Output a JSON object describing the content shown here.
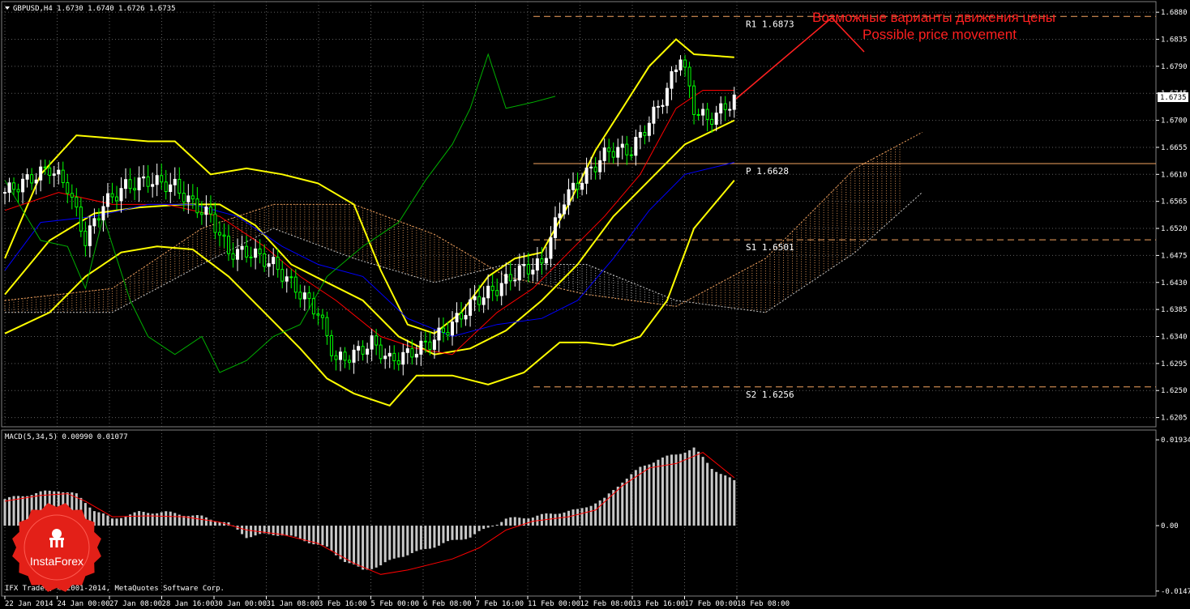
{
  "header": {
    "symbol_line": "GBPUSD,H4  1.6730 1.6740 1.6726 1.6735",
    "macd_line": "MACD(5,34,5) 0.00990 0.01077",
    "copyright": "IFX Trader, © 2001-2014, MetaQuotes Software Corp."
  },
  "annotation": {
    "line1": "Возможные варианты движения цены",
    "line2": "Possible price movement",
    "color": "#ff2020"
  },
  "logo": {
    "text": "InstaForex",
    "color": "#e32018"
  },
  "colors": {
    "bull": "#ffffff",
    "bear": "#00ff00",
    "bollinger": "#ffff00",
    "kijun": "#ff0000",
    "tenkan": "#0000ff",
    "chikou": "#00b000",
    "cloud_up": "#f4a460",
    "cloud_down": "#c8c8c8",
    "pivot": "#f4a460",
    "grid": "#606060",
    "macd_hist": "#c8c8c8",
    "macd_signal": "#ff0000"
  },
  "levels": [
    {
      "name": "R1",
      "label": "R1  1.6873",
      "value": 1.6873,
      "style": "dash"
    },
    {
      "name": "P",
      "label": "P  1.6628",
      "value": 1.6628,
      "style": "solid"
    },
    {
      "name": "S1",
      "label": "S1  1.6501",
      "value": 1.6501,
      "style": "dash"
    },
    {
      "name": "S2",
      "label": "S2  1.6256",
      "value": 1.6256,
      "style": "dash"
    }
  ],
  "current_price": "1.6735",
  "chart_data": [
    {
      "type": "candlestick",
      "title": "GBPUSD,H4",
      "ylim": [
        1.6195,
        1.6895
      ],
      "y_ticks": [
        "1.6880",
        "1.6835",
        "1.6790",
        "1.6745",
        "1.6700",
        "1.6655",
        "1.6610",
        "1.6565",
        "1.6520",
        "1.6475",
        "1.6430",
        "1.6385",
        "1.6340",
        "1.6295",
        "1.6250",
        "1.6205"
      ],
      "x_ticks": [
        "22 Jan 2014",
        "24 Jan 00:00",
        "27 Jan 08:00",
        "28 Jan 16:00",
        "30 Jan 00:00",
        "31 Jan 08:00",
        "3 Feb 16:00",
        "5 Feb 00:00",
        "6 Feb 08:00",
        "7 Feb 16:00",
        "11 Feb 00:00",
        "12 Feb 08:00",
        "13 Feb 16:00",
        "17 Feb 00:00",
        "18 Feb 08:00"
      ],
      "close_anchors": [
        [
          0,
          1.658
        ],
        [
          5,
          1.66
        ],
        [
          10,
          1.662
        ],
        [
          14,
          1.659
        ],
        [
          18,
          1.65
        ],
        [
          22,
          1.656
        ],
        [
          27,
          1.659
        ],
        [
          32,
          1.66
        ],
        [
          38,
          1.659
        ],
        [
          42,
          1.656
        ],
        [
          46,
          1.654
        ],
        [
          50,
          1.648
        ],
        [
          55,
          1.648
        ],
        [
          60,
          1.646
        ],
        [
          65,
          1.642
        ],
        [
          70,
          1.638
        ],
        [
          74,
          1.63
        ],
        [
          78,
          1.631
        ],
        [
          82,
          1.633
        ],
        [
          86,
          1.63
        ],
        [
          90,
          1.631
        ],
        [
          95,
          1.633
        ],
        [
          100,
          1.636
        ],
        [
          105,
          1.64
        ],
        [
          110,
          1.642
        ],
        [
          115,
          1.645
        ],
        [
          120,
          1.646
        ],
        [
          125,
          1.657
        ],
        [
          130,
          1.661
        ],
        [
          135,
          1.665
        ],
        [
          140,
          1.665
        ],
        [
          145,
          1.671
        ],
        [
          148,
          1.675
        ],
        [
          151,
          1.681
        ],
        [
          154,
          1.672
        ],
        [
          157,
          1.67
        ],
        [
          160,
          1.6716
        ],
        [
          163,
          1.6735
        ]
      ],
      "series": [
        {
          "name": "Bollinger Bands",
          "upper": [
            [
              0,
              1.647
            ],
            [
              8,
              1.661
            ],
            [
              16,
              1.6675
            ],
            [
              24,
              1.667
            ],
            [
              32,
              1.6665
            ],
            [
              38,
              1.6665
            ],
            [
              46,
              1.661
            ],
            [
              54,
              1.662
            ],
            [
              62,
              1.661
            ],
            [
              70,
              1.6595
            ],
            [
              78,
              1.656
            ],
            [
              84,
              1.645
            ],
            [
              90,
              1.636
            ],
            [
              96,
              1.6345
            ],
            [
              102,
              1.638
            ],
            [
              108,
              1.644
            ],
            [
              114,
              1.647
            ],
            [
              120,
              1.648
            ],
            [
              126,
              1.656
            ],
            [
              132,
              1.665
            ],
            [
              138,
              1.672
            ],
            [
              144,
              1.679
            ],
            [
              150,
              1.6835
            ],
            [
              154,
              1.681
            ],
            [
              163,
              1.6805
            ]
          ],
          "middle": [
            [
              0,
              1.641
            ],
            [
              10,
              1.65
            ],
            [
              20,
              1.6545
            ],
            [
              30,
              1.6555
            ],
            [
              40,
              1.656
            ],
            [
              48,
              1.656
            ],
            [
              56,
              1.6525
            ],
            [
              64,
              1.646
            ],
            [
              72,
              1.643
            ],
            [
              80,
              1.64
            ],
            [
              88,
              1.634
            ],
            [
              96,
              1.631
            ],
            [
              104,
              1.632
            ],
            [
              112,
              1.635
            ],
            [
              120,
              1.64
            ],
            [
              128,
              1.646
            ],
            [
              136,
              1.654
            ],
            [
              144,
              1.66
            ],
            [
              152,
              1.666
            ],
            [
              163,
              1.67
            ]
          ],
          "lower": [
            [
              0,
              1.6345
            ],
            [
              10,
              1.638
            ],
            [
              18,
              1.644
            ],
            [
              26,
              1.648
            ],
            [
              34,
              1.649
            ],
            [
              42,
              1.6485
            ],
            [
              50,
              1.644
            ],
            [
              58,
              1.638
            ],
            [
              66,
              1.632
            ],
            [
              72,
              1.627
            ],
            [
              78,
              1.6245
            ],
            [
              86,
              1.6225
            ],
            [
              92,
              1.6275
            ],
            [
              100,
              1.6275
            ],
            [
              108,
              1.626
            ],
            [
              116,
              1.628
            ],
            [
              124,
              1.633
            ],
            [
              130,
              1.633
            ],
            [
              136,
              1.6325
            ],
            [
              142,
              1.634
            ],
            [
              148,
              1.64
            ],
            [
              154,
              1.652
            ],
            [
              163,
              1.66
            ]
          ]
        },
        {
          "name": "Ichimoku Kijun",
          "values": [
            [
              0,
              1.655
            ],
            [
              12,
              1.658
            ],
            [
              24,
              1.656
            ],
            [
              36,
              1.656
            ],
            [
              48,
              1.654
            ],
            [
              58,
              1.649
            ],
            [
              66,
              1.644
            ],
            [
              74,
              1.64
            ],
            [
              84,
              1.634
            ],
            [
              92,
              1.632
            ],
            [
              100,
              1.631
            ],
            [
              110,
              1.638
            ],
            [
              118,
              1.642
            ],
            [
              126,
              1.648
            ],
            [
              134,
              1.654
            ],
            [
              142,
              1.661
            ],
            [
              150,
              1.672
            ],
            [
              156,
              1.675
            ],
            [
              163,
              1.675
            ]
          ]
        },
        {
          "name": "Ichimoku Tenkan",
          "values": [
            [
              0,
              1.645
            ],
            [
              8,
              1.653
            ],
            [
              20,
              1.654
            ],
            [
              32,
              1.656
            ],
            [
              42,
              1.656
            ],
            [
              52,
              1.654
            ],
            [
              62,
              1.649
            ],
            [
              70,
              1.646
            ],
            [
              80,
              1.644
            ],
            [
              90,
              1.637
            ],
            [
              100,
              1.634
            ],
            [
              110,
              1.636
            ],
            [
              120,
              1.637
            ],
            [
              128,
              1.64
            ],
            [
              136,
              1.647
            ],
            [
              144,
              1.655
            ],
            [
              152,
              1.661
            ],
            [
              163,
              1.663
            ]
          ]
        },
        {
          "name": "Ichimoku Chikou",
          "values": [
            [
              0,
              1.66
            ],
            [
              8,
              1.65
            ],
            [
              14,
              1.649
            ],
            [
              18,
              1.642
            ],
            [
              22,
              1.654
            ],
            [
              28,
              1.64
            ],
            [
              32,
              1.634
            ],
            [
              38,
              1.631
            ],
            [
              44,
              1.634
            ],
            [
              48,
              1.628
            ],
            [
              54,
              1.63
            ],
            [
              60,
              1.634
            ],
            [
              66,
              1.636
            ],
            [
              72,
              1.644
            ],
            [
              80,
              1.649
            ],
            [
              88,
              1.653
            ],
            [
              94,
              1.66
            ],
            [
              100,
              1.666
            ],
            [
              104,
              1.672
            ],
            [
              108,
              1.681
            ],
            [
              112,
              1.672
            ],
            [
              118,
              1.673
            ],
            [
              123,
              1.674
            ]
          ]
        }
      ],
      "cloud": {
        "span_a": [
          [
            0,
            1.64
          ],
          [
            24,
            1.642
          ],
          [
            44,
            1.652
          ],
          [
            60,
            1.656
          ],
          [
            78,
            1.656
          ],
          [
            96,
            1.651
          ],
          [
            112,
            1.644
          ],
          [
            130,
            1.641
          ],
          [
            150,
            1.639
          ],
          [
            170,
            1.647
          ],
          [
            190,
            1.662
          ],
          [
            205,
            1.668
          ]
        ],
        "span_b": [
          [
            0,
            1.638
          ],
          [
            24,
            1.638
          ],
          [
            44,
            1.646
          ],
          [
            60,
            1.652
          ],
          [
            78,
            1.647
          ],
          [
            96,
            1.643
          ],
          [
            112,
            1.646
          ],
          [
            130,
            1.646
          ],
          [
            150,
            1.64
          ],
          [
            170,
            1.638
          ],
          [
            190,
            1.648
          ],
          [
            205,
            1.658
          ]
        ]
      }
    },
    {
      "type": "bar",
      "title": "MACD(5,34,5) 0.00990 0.01077",
      "ylim": [
        -0.0155,
        0.021
      ],
      "y_ticks": [
        "0.01934",
        "0.00",
        "-0.01474"
      ],
      "anchors": [
        [
          0,
          0.006
        ],
        [
          8,
          0.0075
        ],
        [
          12,
          0.008
        ],
        [
          16,
          0.007
        ],
        [
          20,
          0.0035
        ],
        [
          24,
          0.0015
        ],
        [
          30,
          0.003
        ],
        [
          36,
          0.003
        ],
        [
          44,
          0.002
        ],
        [
          50,
          0.0005
        ],
        [
          54,
          -0.0025
        ],
        [
          58,
          -0.002
        ],
        [
          62,
          -0.002
        ],
        [
          66,
          -0.003
        ],
        [
          72,
          -0.005
        ],
        [
          76,
          -0.008
        ],
        [
          80,
          -0.01
        ],
        [
          84,
          -0.009
        ],
        [
          88,
          -0.007
        ],
        [
          92,
          -0.006
        ],
        [
          98,
          -0.004
        ],
        [
          104,
          -0.0025
        ],
        [
          108,
          -0.0005
        ],
        [
          112,
          0.0015
        ],
        [
          118,
          0.002
        ],
        [
          124,
          0.003
        ],
        [
          128,
          0.0035
        ],
        [
          134,
          0.006
        ],
        [
          138,
          0.01
        ],
        [
          142,
          0.013
        ],
        [
          146,
          0.015
        ],
        [
          150,
          0.016
        ],
        [
          154,
          0.0175
        ],
        [
          158,
          0.013
        ],
        [
          163,
          0.01
        ]
      ],
      "signal": [
        [
          0,
          0.0055
        ],
        [
          8,
          0.0068
        ],
        [
          14,
          0.0072
        ],
        [
          18,
          0.0055
        ],
        [
          24,
          0.002
        ],
        [
          32,
          0.0022
        ],
        [
          40,
          0.002
        ],
        [
          48,
          0.0008
        ],
        [
          54,
          -0.001
        ],
        [
          62,
          -0.002
        ],
        [
          70,
          -0.004
        ],
        [
          78,
          -0.0085
        ],
        [
          84,
          -0.011
        ],
        [
          90,
          -0.01
        ],
        [
          100,
          -0.0075
        ],
        [
          106,
          -0.005
        ],
        [
          112,
          -0.001
        ],
        [
          118,
          0.001
        ],
        [
          126,
          0.002
        ],
        [
          132,
          0.0035
        ],
        [
          138,
          0.009
        ],
        [
          144,
          0.013
        ],
        [
          150,
          0.014
        ],
        [
          156,
          0.0165
        ],
        [
          163,
          0.0108
        ]
      ]
    }
  ]
}
